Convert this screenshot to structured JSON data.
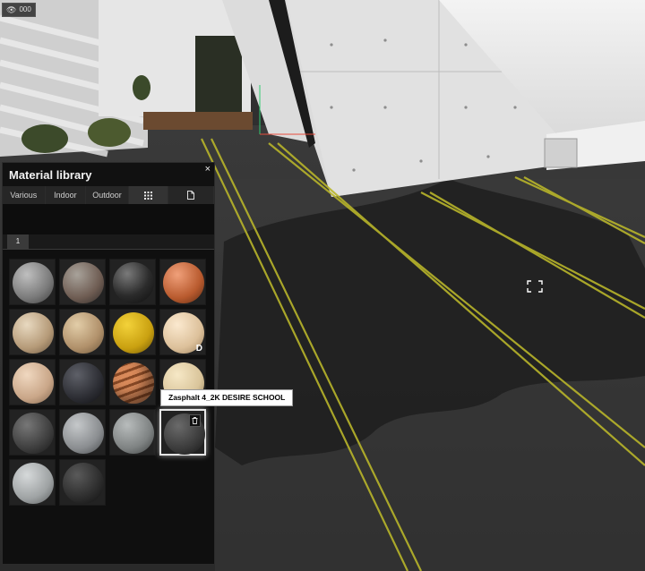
{
  "viewport": {
    "badge_text": "000",
    "badge_icon": "eye-icon",
    "accent_line_color": "#b8b52a"
  },
  "panel": {
    "title": "Material library",
    "close_label": "×",
    "tabs": [
      {
        "label": "Various"
      },
      {
        "label": "Indoor"
      },
      {
        "label": "Outdoor"
      }
    ],
    "grid_view_icon": "grid-icon",
    "document_icon": "document-icon",
    "page_tab_label": "1"
  },
  "materials": [
    {
      "name": "concrete-grey"
    },
    {
      "name": "stone-mixed"
    },
    {
      "name": "dark-glossy"
    },
    {
      "name": "copper-orange"
    },
    {
      "name": "gravel-beige"
    },
    {
      "name": "gravel-tan"
    },
    {
      "name": "yellow-fabric"
    },
    {
      "name": "cream-plaster",
      "badge": "D"
    },
    {
      "name": "light-wood"
    },
    {
      "name": "dark-rubber"
    },
    {
      "name": "striped-wood"
    },
    {
      "name": "ivory-matte"
    },
    {
      "name": "dark-grey-matte"
    },
    {
      "name": "grey-matte"
    },
    {
      "name": "grey-rough"
    },
    {
      "name": "asphalt-dark",
      "selected": true,
      "trash": true
    },
    {
      "name": "light-grey"
    },
    {
      "name": "tile-dark"
    }
  ],
  "tooltip": {
    "text": "Zasphalt 4_2K DESIRE SCHOOL"
  }
}
